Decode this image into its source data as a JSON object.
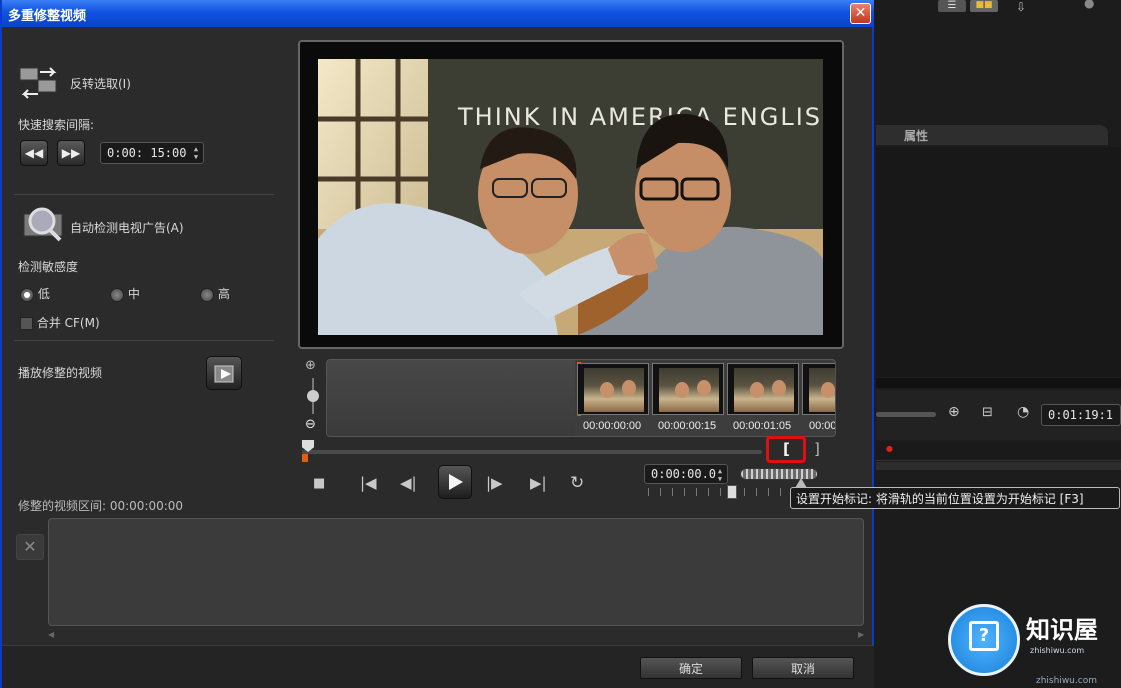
{
  "dialog": {
    "title": "多重修整视频",
    "close_glyph": "✕"
  },
  "left_panel": {
    "invert_selection_label": "反转选取(I)",
    "quick_search_label": "快速搜索间隔:",
    "quick_search_value": "0:00: 15:00",
    "auto_detect_label": "自动检测电视广告(A)",
    "sensitivity_label": "检测敏感度",
    "sensitivity_options": [
      "低",
      "中",
      "高"
    ],
    "sensitivity_selected": "低",
    "merge_label": "合并 CF(M)",
    "play_trimmed_label": "播放修整的视频"
  },
  "timeline": {
    "thumbnail_timecodes": [
      "00:00:00:00",
      "00:00:00:15",
      "00:00:01:05",
      "00:00"
    ],
    "current_time": "0:00:00.0",
    "mark_in_glyph": "[",
    "mark_out_glyph": "]"
  },
  "trimmed_range": {
    "label": "修整的视频区间: 00:00:00:00"
  },
  "preview": {
    "chalk_text": "THINK IN AMERICA ENGLISH"
  },
  "buttons": {
    "ok": "确定",
    "cancel": "取消"
  },
  "tooltip": "设置开始标记: 将滑轨的当前位置设置为开始标记 [F3]",
  "background_app": {
    "properties_label": "属性",
    "timecode": "0:01:19:1"
  },
  "watermark": {
    "brand": "知识屋",
    "domain_small": "zhishiwu.com",
    "domain_footer": "zhishiwu.com"
  },
  "colors": {
    "title_bar": "#0f52e0",
    "highlight_box": "#e01010",
    "dialog_bg": "#2b2b2b"
  }
}
